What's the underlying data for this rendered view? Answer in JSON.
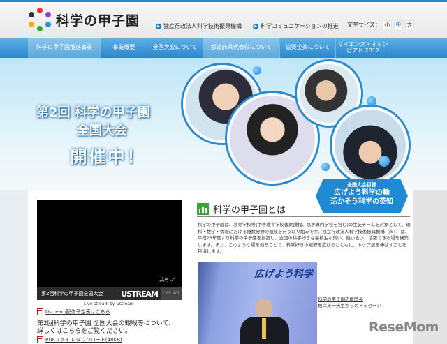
{
  "header": {
    "logo_text": "科学の甲子園",
    "links": [
      "独立行政法人科学技術振興機構",
      "科学コミュニケーションの推進"
    ],
    "font_size_label": "文字サイズ：",
    "font_sizes": [
      "小",
      "中",
      "大"
    ]
  },
  "nav": [
    "科学の甲子園推進事業",
    "事業概要",
    "全国大会について",
    "都道府県代表校について",
    "協賛企業について",
    "サイエンス・オリンピアド 2012"
  ],
  "hero": {
    "line1": "第2回 科学の甲子園",
    "line2": "全国大会",
    "line3": "開催中！",
    "goal_label": "全国大会目標",
    "goal_line1": "広げよう科学の輪",
    "goal_line2": "活かそう科学の英知"
  },
  "video": {
    "title": "第2回科学の甲子園全国大会",
    "brand": "USTREAM",
    "status": "OFF AIR",
    "share": "共有",
    "caption": "Live stream by Ustream",
    "schedule_link": "Ustream配信予定表はこちら"
  },
  "notice": {
    "text1": "第2回科学の甲子園 全国大会の観戦等について、",
    "text2_pre": "詳しくは",
    "text2_link": "こちら",
    "text2_post": "をご覧ください。",
    "pdf_link": "PDFファイル ダウンロード(48KB)"
  },
  "about": {
    "title": "科学の甲子園とは",
    "description": "科学の甲子園は、高等学校等(中等教育学校後期課程、高等専門学校を含む)の生徒チームを対象として、理科・数学・情報における複数分野の競技を行う取り組みです。独立行政法人科学技術振興機構（JST）は、平成23年度より科学の甲子園を創設し、全国の科学好きな高校生が集い、競い合い、活躍できる場を構築します。また、このような場を創ることで、科学好きの裾野を広げるとともに、トップ層を伸ばすことを目指します。",
    "photo_banner": "広げよう科学",
    "message_line1": "科学の甲子園応援団長",
    "message_line2": "根岸英一先生からのメッセージ"
  },
  "watermark": "ReseMom"
}
